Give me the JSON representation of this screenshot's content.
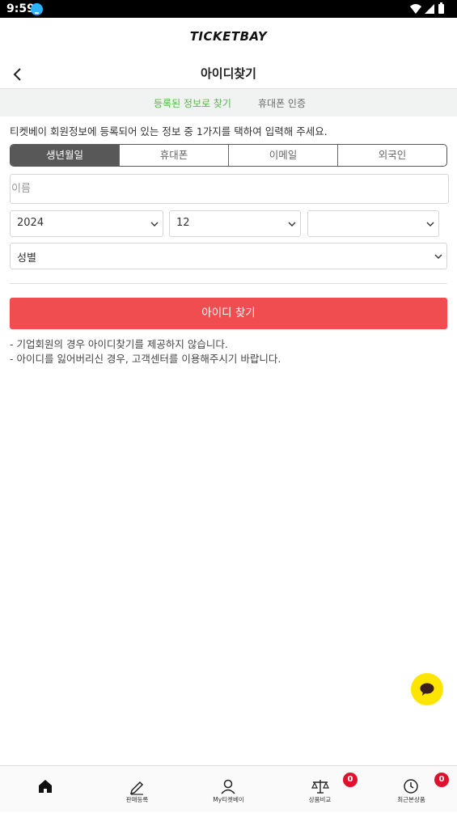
{
  "status_bar": {
    "time": "9:59"
  },
  "brand": "TICKETBAY",
  "header": {
    "title": "아이디찾기"
  },
  "subtabs": [
    {
      "label": "등록된 정보로 찾기",
      "active": true
    },
    {
      "label": "휴대폰 인증",
      "active": false
    }
  ],
  "description": "티켓베이 회원정보에 등록되어 있는 정보 중 1가지를 택하여 입력해 주세요.",
  "method_tabs": [
    {
      "label": "생년월일",
      "active": true
    },
    {
      "label": "휴대폰",
      "active": false
    },
    {
      "label": "이메일",
      "active": false
    },
    {
      "label": "외국인",
      "active": false
    }
  ],
  "form": {
    "name_placeholder": "이름",
    "year": "2024",
    "month": "12",
    "day": "",
    "gender": "성별",
    "submit_label": "아이디 찾기"
  },
  "notes": [
    "- 기업회원의 경우 아이디찾기를 제공하지 않습니다.",
    "- 아이디를 잃어버리신 경우, 고객센터를 이용해주시기 바랍니다."
  ],
  "bottom_nav": [
    {
      "label": "",
      "icon": "home-icon"
    },
    {
      "label": "판매등록",
      "icon": "pencil-icon"
    },
    {
      "label": "My티켓베이",
      "icon": "user-icon"
    },
    {
      "label": "상품비교",
      "icon": "scale-icon",
      "badge": "0"
    },
    {
      "label": "최근본상품",
      "icon": "clock-icon",
      "badge": "0"
    }
  ],
  "colors": {
    "accent_red": "#ef4d4f",
    "active_green": "#55b84a",
    "chat_yellow": "#fee500",
    "badge_red": "#e0102f"
  }
}
